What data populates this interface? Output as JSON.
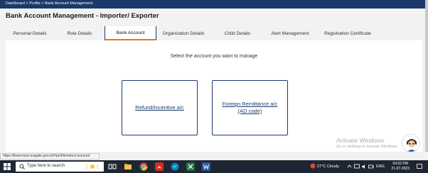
{
  "breadcrumb": {
    "home": "Dashboard",
    "sep": ">",
    "profile": "Profile",
    "current": "Bank Account Management"
  },
  "page": {
    "title": "Bank Account Management - Importer/ Exporter"
  },
  "tabs": [
    {
      "label": "Personal Details"
    },
    {
      "label": "Role Details"
    },
    {
      "label": "Bank Account",
      "active": true
    },
    {
      "label": "Organization Details"
    },
    {
      "label": "Child Details"
    },
    {
      "label": "Alert Management"
    },
    {
      "label": "Registration Certificate"
    }
  ],
  "content": {
    "prompt": "Select the account you want to manage",
    "cards": [
      {
        "line1": "Refund/Incentive a/c",
        "line2": ""
      },
      {
        "line1": "Foreign Remittance a/c",
        "line2": "(AD code)"
      }
    ]
  },
  "watermark": {
    "line1": "Activate Windows",
    "line2": "Go to Settings to activate Windows."
  },
  "status_url": "https://foservices.icegate.gov.in/#/profile/select-account",
  "taskbar": {
    "search_placeholder": "Type here to search",
    "weather": "27°C  Cloudy",
    "lang": "ENG",
    "time": "04:52 PM",
    "date": "21-07-2023"
  },
  "colors": {
    "brand_navy": "#1b3a6b",
    "tab_underline": "#e07a1a",
    "taskbar": "#1f2633"
  }
}
